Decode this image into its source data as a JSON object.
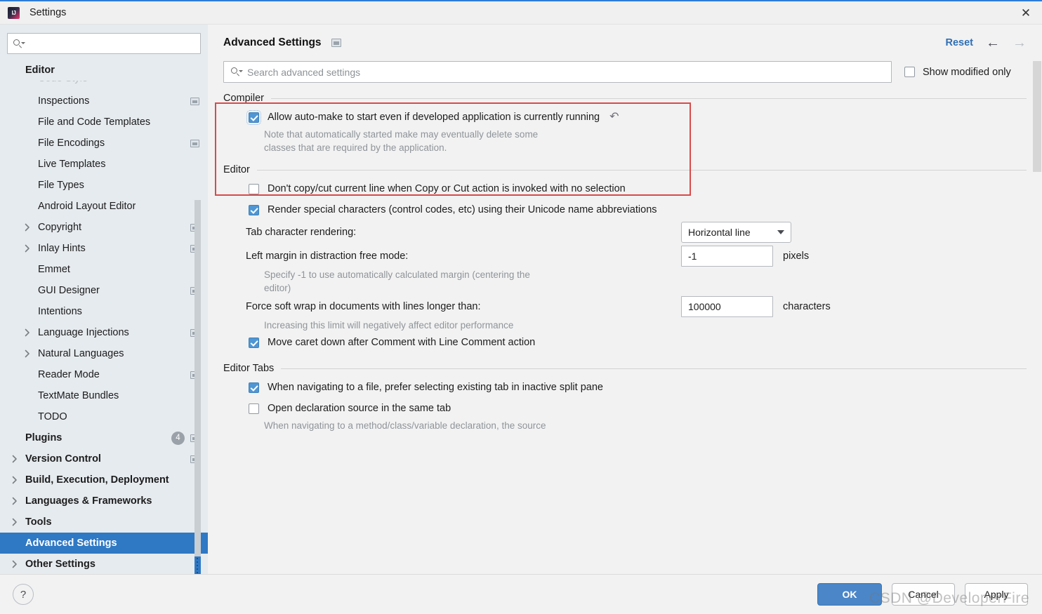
{
  "window": {
    "title": "Settings",
    "close_label": "✕",
    "logo": "intellij-idea-logo"
  },
  "sidebar": {
    "search": {
      "value": "",
      "placeholder": ""
    },
    "items": [
      {
        "label": "Editor",
        "bold": true,
        "indent": 0,
        "twisty": "",
        "mono": false,
        "clipped": false
      },
      {
        "label": "Code Style",
        "bold": false,
        "indent": 1,
        "twisty": "",
        "mono": false,
        "clipped": true
      },
      {
        "label": "Inspections",
        "bold": false,
        "indent": 1,
        "twisty": "",
        "mono": true,
        "clipped": false
      },
      {
        "label": "File and Code Templates",
        "bold": false,
        "indent": 1,
        "twisty": "",
        "mono": false,
        "clipped": false
      },
      {
        "label": "File Encodings",
        "bold": false,
        "indent": 1,
        "twisty": "",
        "mono": true,
        "clipped": false
      },
      {
        "label": "Live Templates",
        "bold": false,
        "indent": 1,
        "twisty": "",
        "mono": false,
        "clipped": false
      },
      {
        "label": "File Types",
        "bold": false,
        "indent": 1,
        "twisty": "",
        "mono": false,
        "clipped": false
      },
      {
        "label": "Android Layout Editor",
        "bold": false,
        "indent": 1,
        "twisty": "",
        "mono": false,
        "clipped": false
      },
      {
        "label": "Copyright",
        "bold": false,
        "indent": 1,
        "twisty": "collapsed",
        "mono": true,
        "clipped": false
      },
      {
        "label": "Inlay Hints",
        "bold": false,
        "indent": 1,
        "twisty": "collapsed",
        "mono": true,
        "clipped": false
      },
      {
        "label": "Emmet",
        "bold": false,
        "indent": 1,
        "twisty": "",
        "mono": false,
        "clipped": false
      },
      {
        "label": "GUI Designer",
        "bold": false,
        "indent": 1,
        "twisty": "",
        "mono": true,
        "clipped": false
      },
      {
        "label": "Intentions",
        "bold": false,
        "indent": 1,
        "twisty": "",
        "mono": false,
        "clipped": false
      },
      {
        "label": "Language Injections",
        "bold": false,
        "indent": 1,
        "twisty": "collapsed",
        "mono": true,
        "clipped": false
      },
      {
        "label": "Natural Languages",
        "bold": false,
        "indent": 1,
        "twisty": "collapsed",
        "mono": false,
        "clipped": false
      },
      {
        "label": "Reader Mode",
        "bold": false,
        "indent": 1,
        "twisty": "",
        "mono": true,
        "clipped": false
      },
      {
        "label": "TextMate Bundles",
        "bold": false,
        "indent": 1,
        "twisty": "",
        "mono": false,
        "clipped": false
      },
      {
        "label": "TODO",
        "bold": false,
        "indent": 1,
        "twisty": "",
        "mono": false,
        "clipped": false
      },
      {
        "label": "Plugins",
        "bold": true,
        "indent": 0,
        "twisty": "",
        "mono": true,
        "badge": "4",
        "clipped": false
      },
      {
        "label": "Version Control",
        "bold": true,
        "indent": 0,
        "twisty": "collapsed",
        "mono": true,
        "clipped": false
      },
      {
        "label": "Build, Execution, Deployment",
        "bold": true,
        "indent": 0,
        "twisty": "collapsed",
        "mono": false,
        "clipped": false
      },
      {
        "label": "Languages & Frameworks",
        "bold": true,
        "indent": 0,
        "twisty": "collapsed",
        "mono": false,
        "clipped": false
      },
      {
        "label": "Tools",
        "bold": true,
        "indent": 0,
        "twisty": "collapsed",
        "mono": false,
        "clipped": false
      },
      {
        "label": "Advanced Settings",
        "bold": true,
        "indent": 0,
        "twisty": "",
        "mono": false,
        "selected": true,
        "clipped": false
      },
      {
        "label": "Other Settings",
        "bold": true,
        "indent": 0,
        "twisty": "collapsed",
        "mono": false,
        "clipped": false
      }
    ]
  },
  "header": {
    "page_title": "Advanced Settings",
    "reset_label": "Reset",
    "back_arrow": "←",
    "forward_arrow": "→"
  },
  "search": {
    "value": "",
    "placeholder": "Search advanced settings",
    "show_modified_label": "Show modified only",
    "show_modified_checked": false
  },
  "sections": [
    {
      "title": "Compiler",
      "highlighted": true,
      "rows": [
        {
          "kind": "checkbox",
          "checked": true,
          "focus": true,
          "label": "Allow auto-make to start even if developed application is currently running",
          "revert": true
        },
        {
          "kind": "hint",
          "text": "Note that automatically started make may eventually delete some"
        },
        {
          "kind": "hint",
          "text": "classes that are required by the application."
        }
      ]
    },
    {
      "title": "Editor",
      "highlighted": false,
      "rows": [
        {
          "kind": "checkbox",
          "checked": false,
          "label": "Don't copy/cut current line when Copy or Cut action is invoked with no selection"
        },
        {
          "kind": "checkbox",
          "checked": true,
          "label": "Render special characters (control codes, etc) using their Unicode name abbreviations"
        },
        {
          "kind": "combo",
          "label": "Tab character rendering:",
          "value": "Horizontal line",
          "unit": ""
        },
        {
          "kind": "input",
          "label": "Left margin in distraction free mode:",
          "value": "-1",
          "unit": "pixels"
        },
        {
          "kind": "hint",
          "text": "Specify -1 to use automatically calculated margin (centering the"
        },
        {
          "kind": "hint",
          "text": "editor)"
        },
        {
          "kind": "input",
          "label": "Force soft wrap in documents with lines longer than:",
          "value": "100000",
          "unit": "characters"
        },
        {
          "kind": "hint",
          "text": "Increasing this limit will negatively affect editor performance"
        },
        {
          "kind": "checkbox",
          "checked": true,
          "label": "Move caret down after Comment with Line Comment action"
        }
      ]
    },
    {
      "title": "Editor Tabs",
      "highlighted": false,
      "rows": [
        {
          "kind": "checkbox",
          "checked": true,
          "label": "When navigating to a file, prefer selecting existing tab in inactive split pane"
        },
        {
          "kind": "checkbox",
          "checked": false,
          "label": "Open declaration source in the same tab"
        },
        {
          "kind": "hint",
          "text": "When navigating to a method/class/variable declaration, the source"
        }
      ]
    }
  ],
  "footer": {
    "help_label": "?",
    "ok_label": "OK",
    "cancel_label": "Cancel",
    "apply_label": "Apply"
  },
  "watermark": "CSDN @DeveloperFire",
  "colors": {
    "accent_blue": "#2f78c4",
    "link_blue": "#2f6fb5",
    "checkbox_blue": "#4e96d4",
    "annotation_red": "#d94a4a",
    "sidebar_bg": "#e6ebef",
    "content_bg": "#f2f2f2"
  }
}
